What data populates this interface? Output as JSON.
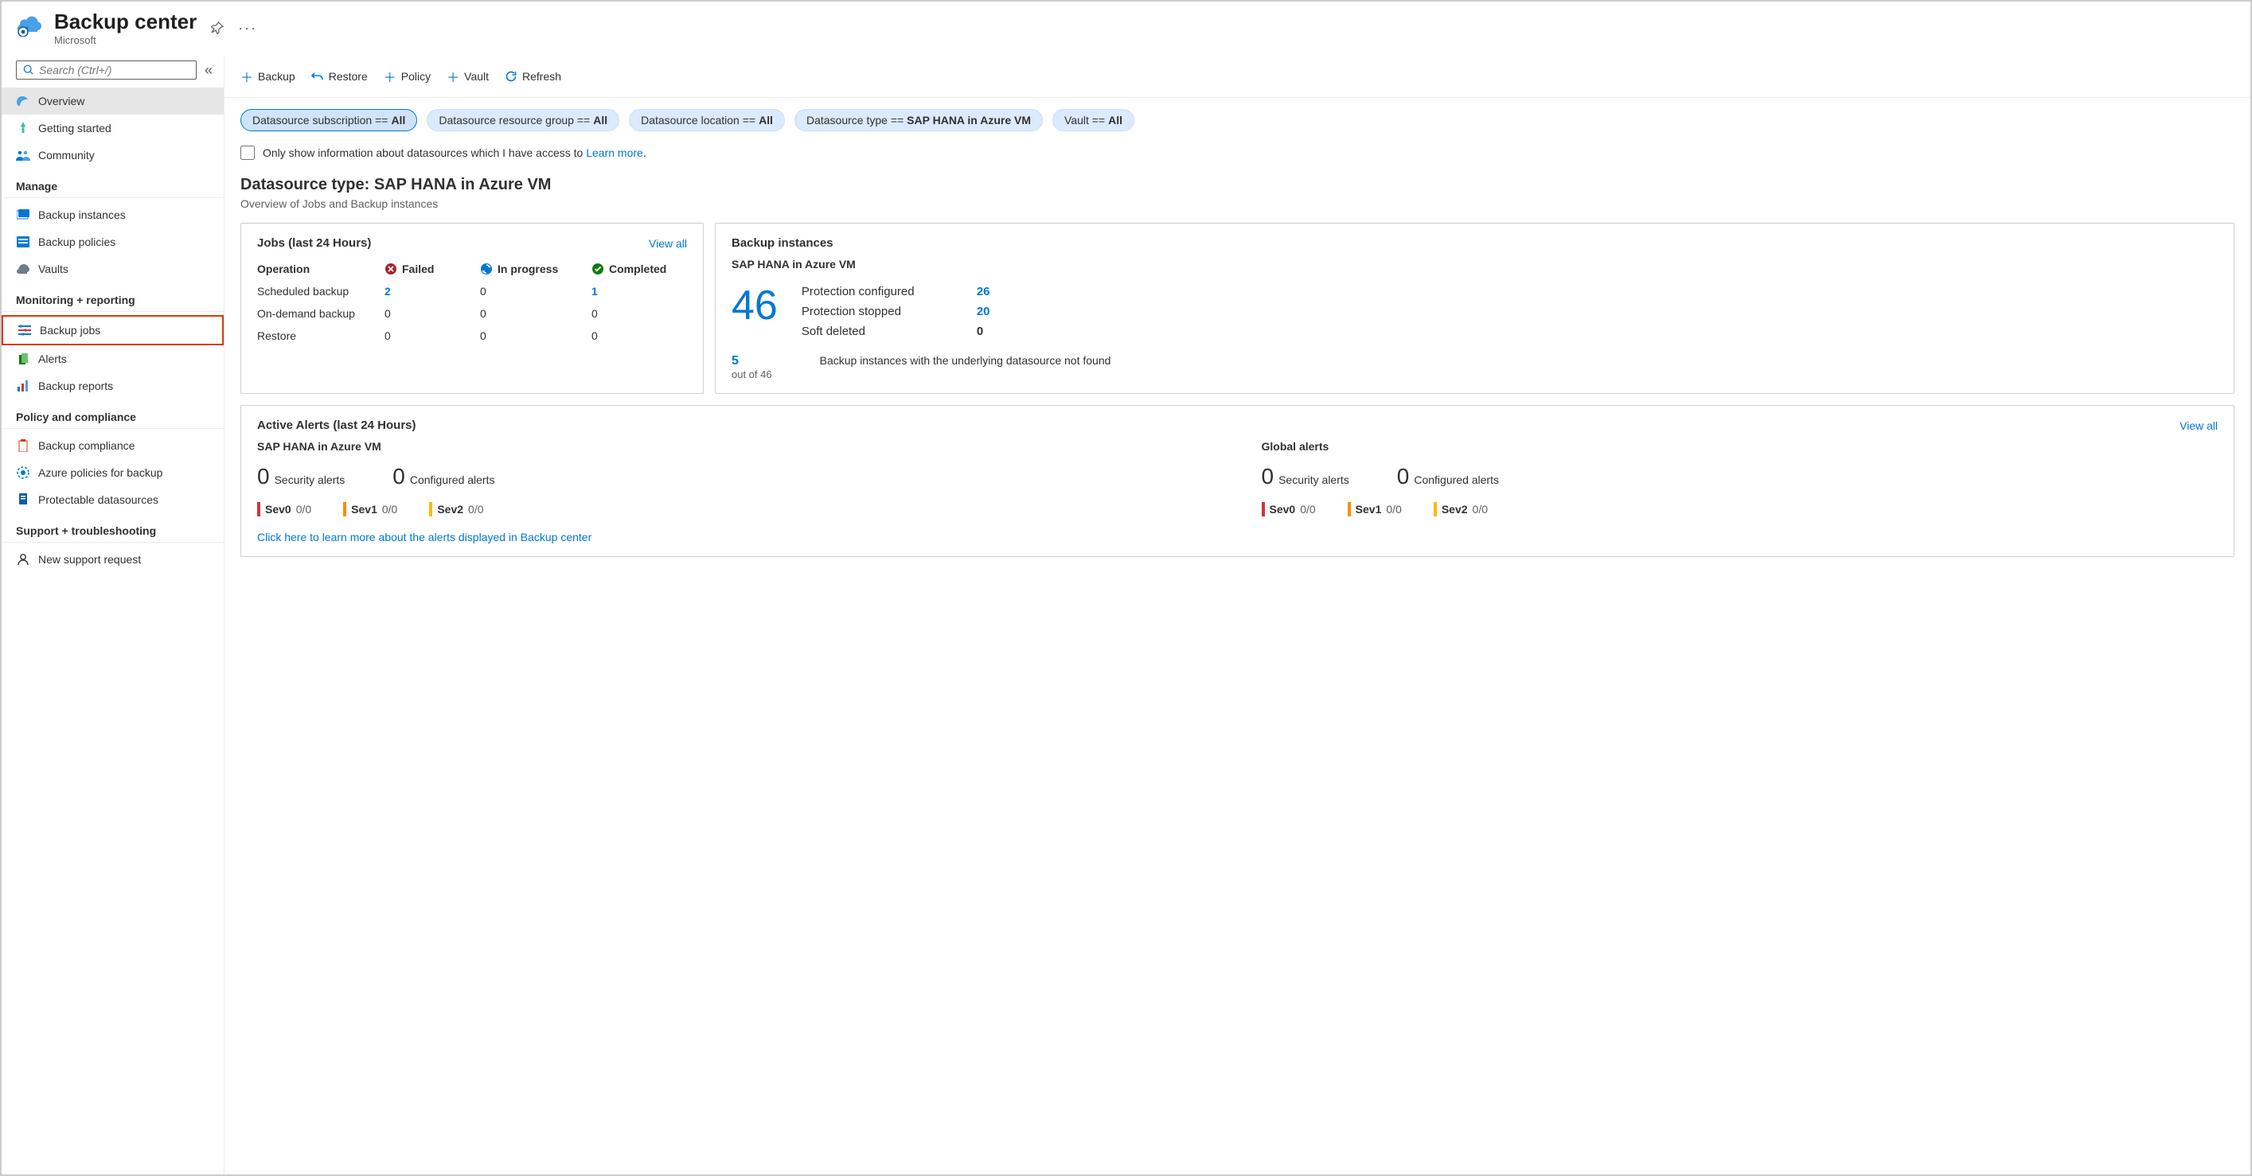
{
  "header": {
    "title": "Backup center",
    "subtitle": "Microsoft"
  },
  "sidebar": {
    "search_placeholder": "Search (Ctrl+/)",
    "top": [
      {
        "label": "Overview"
      },
      {
        "label": "Getting started"
      },
      {
        "label": "Community"
      }
    ],
    "sections": [
      {
        "title": "Manage",
        "items": [
          {
            "label": "Backup instances"
          },
          {
            "label": "Backup policies"
          },
          {
            "label": "Vaults"
          }
        ]
      },
      {
        "title": "Monitoring + reporting",
        "items": [
          {
            "label": "Backup jobs"
          },
          {
            "label": "Alerts"
          },
          {
            "label": "Backup reports"
          }
        ]
      },
      {
        "title": "Policy and compliance",
        "items": [
          {
            "label": "Backup compliance"
          },
          {
            "label": "Azure policies for backup"
          },
          {
            "label": "Protectable datasources"
          }
        ]
      },
      {
        "title": "Support + troubleshooting",
        "items": [
          {
            "label": "New support request"
          }
        ]
      }
    ]
  },
  "toolbar": {
    "backup": "Backup",
    "restore": "Restore",
    "policy": "Policy",
    "vault": "Vault",
    "refresh": "Refresh"
  },
  "filters": {
    "subscription": {
      "label": "Datasource subscription == ",
      "value": "All"
    },
    "resourcegroup": {
      "label": "Datasource resource group == ",
      "value": "All"
    },
    "location": {
      "label": "Datasource location == ",
      "value": "All"
    },
    "type": {
      "label": "Datasource type == ",
      "value": "SAP HANA in Azure VM"
    },
    "vault": {
      "label": "Vault == ",
      "value": "All"
    }
  },
  "access_checkbox": {
    "text_pre": "Only show information about datasources which I have access to ",
    "link": "Learn more",
    "dot": "."
  },
  "overview": {
    "title": "Datasource type: SAP HANA in Azure VM",
    "subtitle": "Overview of Jobs and Backup instances"
  },
  "jobs_card": {
    "title": "Jobs (last 24 Hours)",
    "view_all": "View all",
    "cols": {
      "operation": "Operation",
      "failed": "Failed",
      "inprogress": "In progress",
      "completed": "Completed"
    },
    "rows": [
      {
        "op": "Scheduled backup",
        "failed": "2",
        "failed_link": true,
        "inprogress": "0",
        "completed": "1",
        "completed_link": true
      },
      {
        "op": "On-demand backup",
        "failed": "0",
        "failed_link": false,
        "inprogress": "0",
        "completed": "0",
        "completed_link": false
      },
      {
        "op": "Restore",
        "failed": "0",
        "failed_link": false,
        "inprogress": "0",
        "completed": "0",
        "completed_link": false
      }
    ]
  },
  "instances_card": {
    "title": "Backup instances",
    "subtitle": "SAP HANA in Azure VM",
    "total": "46",
    "stats": [
      {
        "label": "Protection configured",
        "value": "26",
        "link": true
      },
      {
        "label": "Protection stopped",
        "value": "20",
        "link": true
      },
      {
        "label": "Soft deleted",
        "value": "0",
        "link": false
      }
    ],
    "issue_count": "5",
    "issue_outof": "out of 46",
    "issue_text": "Backup instances with the underlying datasource not found"
  },
  "alerts_card": {
    "title": "Active Alerts (last 24 Hours)",
    "view_all": "View all",
    "columns": [
      {
        "title": "SAP HANA in Azure VM",
        "security_count": "0",
        "security_label": "Security alerts",
        "configured_count": "0",
        "configured_label": "Configured alerts",
        "sev": [
          {
            "name": "Sev0",
            "ratio": "0/0"
          },
          {
            "name": "Sev1",
            "ratio": "0/0"
          },
          {
            "name": "Sev2",
            "ratio": "0/0"
          }
        ]
      },
      {
        "title": "Global alerts",
        "security_count": "0",
        "security_label": "Security alerts",
        "configured_count": "0",
        "configured_label": "Configured alerts",
        "sev": [
          {
            "name": "Sev0",
            "ratio": "0/0"
          },
          {
            "name": "Sev1",
            "ratio": "0/0"
          },
          {
            "name": "Sev2",
            "ratio": "0/0"
          }
        ]
      }
    ],
    "footer_link": "Click here to learn more about the alerts displayed in Backup center"
  }
}
